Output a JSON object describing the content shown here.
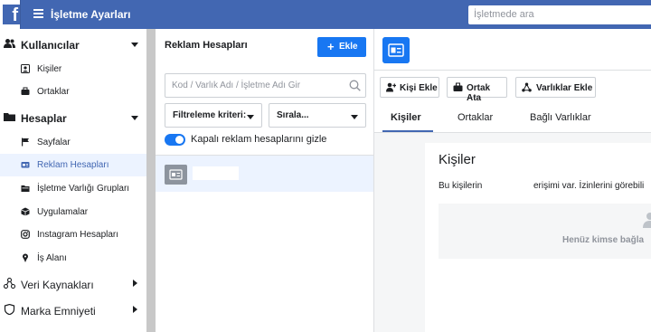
{
  "topbar": {
    "logo_letter": "f",
    "title": "İşletme Ayarları",
    "search_placeholder": "İşletmede ara"
  },
  "sidebar": {
    "sections": [
      {
        "label": "Kullanıcılar",
        "icon": "users-icon",
        "expanded": true,
        "items": [
          {
            "label": "Kişiler",
            "icon": "person-icon"
          },
          {
            "label": "Ortaklar",
            "icon": "briefcase-icon"
          }
        ]
      },
      {
        "label": "Hesaplar",
        "icon": "folder-icon",
        "expanded": true,
        "items": [
          {
            "label": "Sayfalar",
            "icon": "flag-icon"
          },
          {
            "label": "Reklam Hesapları",
            "icon": "ad-account-icon",
            "active": true
          },
          {
            "label": "İşletme Varlığı Grupları",
            "icon": "folder-group-icon"
          },
          {
            "label": "Uygulamalar",
            "icon": "cube-icon"
          },
          {
            "label": "Instagram Hesapları",
            "icon": "instagram-icon"
          },
          {
            "label": "İş Alanı",
            "icon": "pin-icon"
          }
        ]
      },
      {
        "label": "Veri Kaynakları",
        "icon": "data-sources-icon",
        "expanded": false
      },
      {
        "label": "Marka Emniyeti",
        "icon": "shield-icon",
        "expanded": false
      }
    ]
  },
  "middle": {
    "title": "Reklam Hesapları",
    "add_button": "Ekle",
    "search_placeholder": "Kod / Varlık Adı / İşletme Adı Gir",
    "filter_label": "Filtreleme kriteri:",
    "sort_label": "Sırala...",
    "toggle_label": "Kapalı reklam hesaplarını gizle",
    "toggle_on": true
  },
  "right": {
    "actions": [
      {
        "label": "Kişi Ekle",
        "icon": "add-person-icon"
      },
      {
        "label": "Ortak Ata",
        "icon": "briefcase-icon"
      },
      {
        "label": "Varlıklar Ekle",
        "icon": "share-assets-icon"
      }
    ],
    "tabs": [
      "Kişiler",
      "Ortaklar",
      "Bağlı Varlıklar"
    ],
    "active_tab": 0,
    "card_title": "Kişiler",
    "card_desc_part1": "Bu kişilerin",
    "card_desc_part2": "erişimi var. İzinlerini görebili",
    "empty_text": "Henüz kimse bağla"
  },
  "colors": {
    "topbar": "#4267b2",
    "accent": "#1877f2",
    "active_bg": "#ecf3ff"
  }
}
